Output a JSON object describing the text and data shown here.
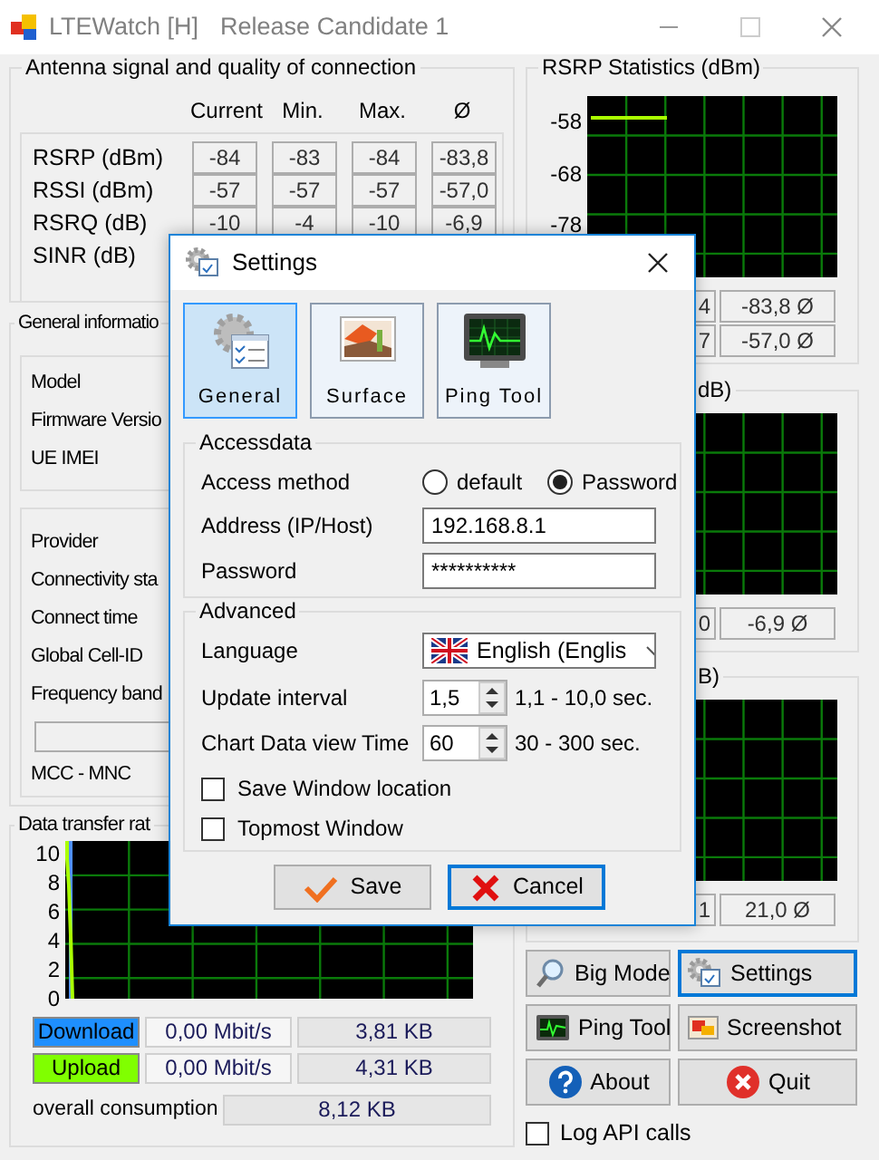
{
  "window": {
    "title": "LTEWatch [H]",
    "subtitle": "Release Candidate 1"
  },
  "signal": {
    "title": "Antenna signal and quality of connection",
    "columns": [
      "Current",
      "Min.",
      "Max.",
      "Ø"
    ],
    "rows": [
      {
        "label": "RSRP (dBm)",
        "values": [
          "-84",
          "-83",
          "-84",
          "-83,8"
        ]
      },
      {
        "label": "RSSI (dBm)",
        "values": [
          "-57",
          "-57",
          "-57",
          "-57,0"
        ]
      },
      {
        "label": "RSRQ (dB)",
        "values": [
          "-10",
          "-4",
          "-10",
          "-6,9"
        ]
      },
      {
        "label": "SINR (dB)"
      }
    ]
  },
  "general_info": {
    "title": "General informatio",
    "device_labels": [
      "Model",
      "Firmware Versio",
      "UE IMEI"
    ],
    "network_labels": [
      "Provider",
      "Connectivity sta",
      "Connect time",
      "Global Cell-ID",
      "Frequency band"
    ],
    "mcc_label": "MCC - MNC"
  },
  "data_transfer": {
    "title": "Data transfer rat",
    "y_axis_labels": [
      "10",
      "8",
      "6",
      "4",
      "2",
      "0"
    ],
    "rows": [
      {
        "label": "Download",
        "color": "#1e8fff",
        "rate": "0,00 Mbit/s",
        "total": "3,81 KB"
      },
      {
        "label": "Upload",
        "color": "#80ff00",
        "rate": "0,00 Mbit/s",
        "total": "4,31 KB"
      }
    ],
    "overall_label": "overall consumption",
    "overall": "8,12 KB"
  },
  "statistics": [
    {
      "title": "RSRP Statistics (dBm)",
      "y_axis_labels": [
        "-58",
        "-68",
        "-78"
      ],
      "stats": [
        [
          "4",
          "-83,8 Ø"
        ],
        [
          "7",
          "-57,0 Ø"
        ]
      ]
    },
    {
      "title": "dB)",
      "stats": [
        [
          "0",
          "-6,9 Ø"
        ]
      ]
    },
    {
      "title": "B)",
      "stats": [
        [
          "1",
          "21,0 Ø"
        ]
      ]
    }
  ],
  "buttons": [
    {
      "label": "Big Mode",
      "kind": "magnifier",
      "focused": false
    },
    {
      "label": "Settings",
      "kind": "gear",
      "focused": true
    },
    {
      "label": "Ping Tool",
      "kind": "monitor",
      "focused": false
    },
    {
      "label": "Screenshot",
      "kind": "picture",
      "focused": false
    },
    {
      "label": "About",
      "kind": "help",
      "focused": false
    },
    {
      "label": "Quit",
      "kind": "quit",
      "focused": false
    }
  ],
  "log_api_calls": {
    "label": "Log API calls",
    "checked": false
  },
  "dialog": {
    "title": "Settings",
    "tabs": [
      {
        "label": "General",
        "kind": "general",
        "selected": true
      },
      {
        "label": "Surface",
        "kind": "surface",
        "selected": false
      },
      {
        "label": "Ping Tool",
        "kind": "ping",
        "selected": false
      }
    ],
    "accessdata": {
      "title": "Accessdata",
      "method_label": "Access method",
      "options": [
        {
          "label": "default",
          "selected": false
        },
        {
          "label": "Password",
          "selected": true
        }
      ],
      "address_label": "Address (IP/Host)",
      "address": "192.168.8.1",
      "password_label": "Password",
      "password": "**********"
    },
    "advanced": {
      "title": "Advanced",
      "language_label": "Language",
      "language": "English (Englis",
      "interval_label": "Update interval",
      "interval": "1,5",
      "interval_range": "1,1 - 10,0 sec.",
      "chart_time_label": "Chart Data view Time",
      "chart_time": "60",
      "chart_time_range": "30 - 300 sec.",
      "checkboxes": [
        {
          "label": "Save Window location",
          "checked": false
        },
        {
          "label": "Topmost Window",
          "checked": false
        }
      ]
    },
    "buttons": [
      {
        "label": "Save",
        "kind": "save",
        "focused": false
      },
      {
        "label": "Cancel",
        "kind": "cancel",
        "focused": true
      }
    ]
  }
}
